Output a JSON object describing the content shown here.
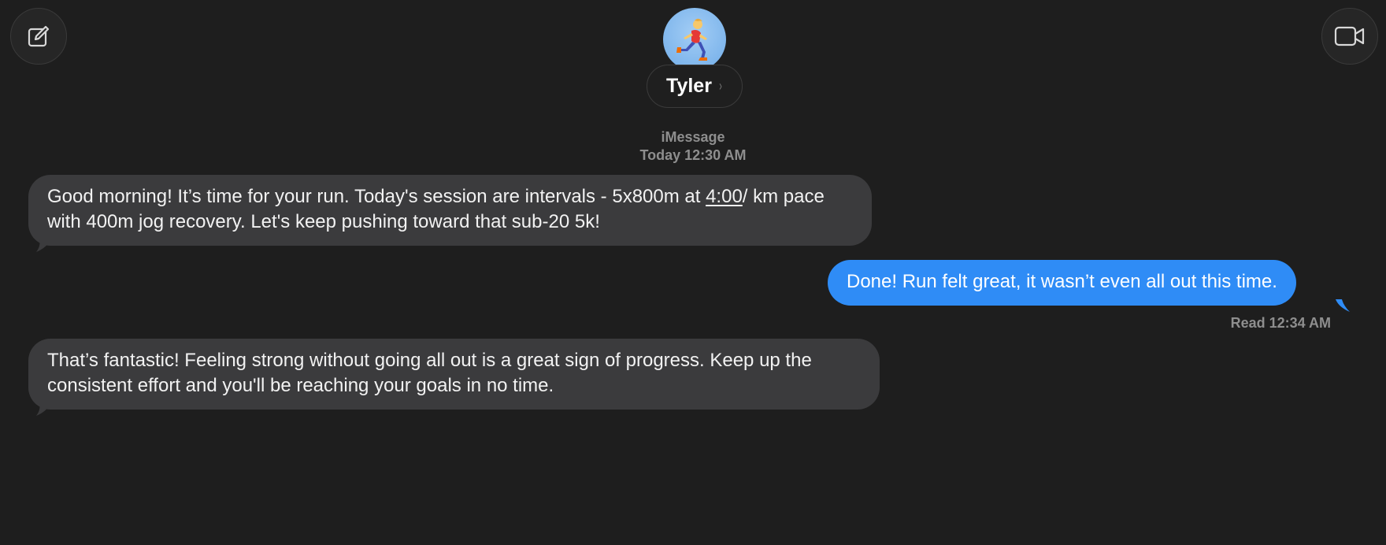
{
  "header": {
    "compose_icon": "compose-icon",
    "video_icon": "video-camera-icon",
    "contact": {
      "name": "Tyler",
      "chevron": "›",
      "avatar_emoji": "🏃"
    }
  },
  "conversation": {
    "service": "iMessage",
    "timestamp": "Today 12:30 AM",
    "messages": [
      {
        "direction": "incoming",
        "text_before": "Good morning! It’s time for your run. Today's session are intervals - 5x800m at ",
        "link_text": "4:00",
        "text_after": "/ km pace with 400m jog recovery. Let's keep pushing toward that sub-20 5k!"
      },
      {
        "direction": "outgoing",
        "text": "Done! Run felt great, it wasn’t even all out this time."
      },
      {
        "direction": "incoming",
        "text": "That’s fantastic! Feeling strong without going all out is a great sign of progress. Keep up the consistent effort and you'll be reaching your goals in no time."
      }
    ],
    "read_receipt": "Read 12:34 AM"
  },
  "colors": {
    "background": "#1e1e1e",
    "incoming_bubble": "#3b3b3d",
    "outgoing_bubble": "#2f8cf6",
    "secondary_text": "#8e8e8e"
  }
}
